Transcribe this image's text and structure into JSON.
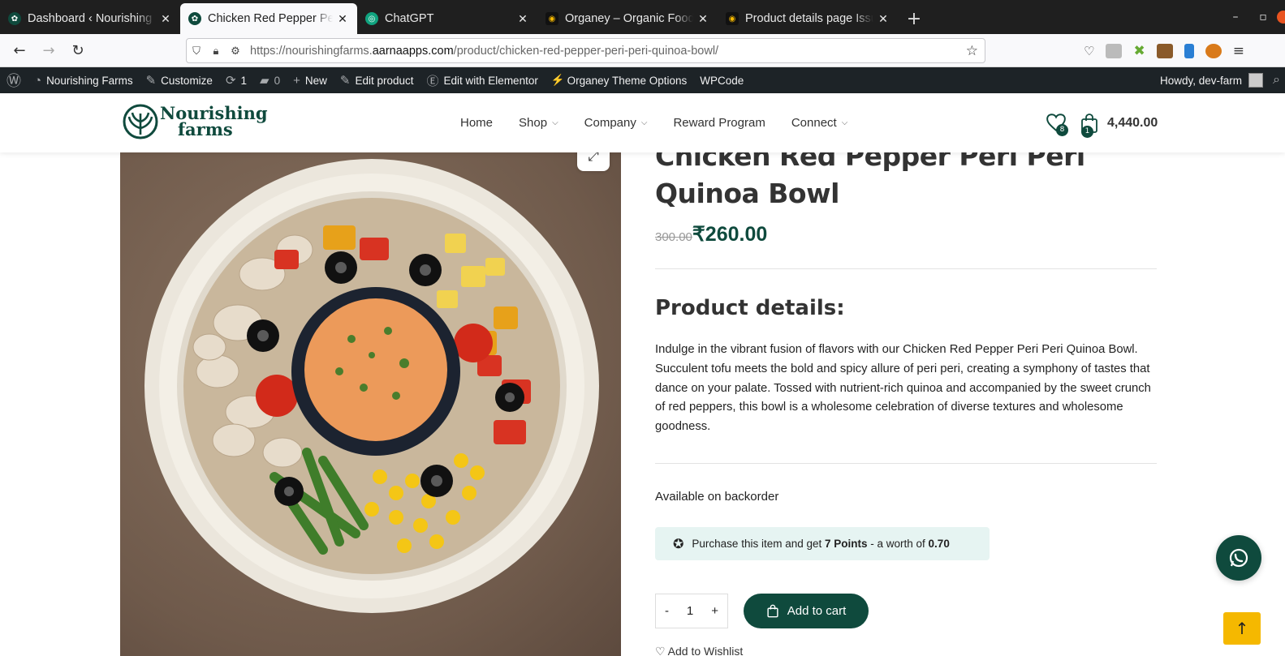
{
  "browser": {
    "tabs": [
      {
        "title": "Dashboard ‹ Nourishing Farms",
        "active": false
      },
      {
        "title": "Chicken Red Pepper Peri Peri",
        "active": true
      },
      {
        "title": "ChatGPT",
        "active": false
      },
      {
        "title": "Organey – Organic Food WordPress",
        "active": false
      },
      {
        "title": "Product details page Issues",
        "active": false
      }
    ],
    "url_prefix": "https://nourishingfarms.",
    "url_domain": "aarnaapps.com",
    "url_path": "/product/chicken-red-pepper-peri-peri-quinoa-bowl/"
  },
  "adminbar": {
    "site_name": "Nourishing Farms",
    "customize": "Customize",
    "updates_count": "1",
    "comments_count": "0",
    "new": "New",
    "edit_product": "Edit product",
    "edit_elementor": "Edit with Elementor",
    "theme_options": "Organey Theme Options",
    "wpcode": "WPCode",
    "howdy": "Howdy, dev-farm"
  },
  "header": {
    "logo_line1": "Nourishing",
    "logo_line2": "farms",
    "nav": [
      {
        "label": "Home",
        "dropdown": false
      },
      {
        "label": "Shop",
        "dropdown": true
      },
      {
        "label": "Company",
        "dropdown": true
      },
      {
        "label": "Reward Program",
        "dropdown": false
      },
      {
        "label": "Connect",
        "dropdown": true
      }
    ],
    "wishlist_count": "8",
    "cart_count": "1",
    "cart_total": "4,440.00"
  },
  "product": {
    "title": "Chicken Red Pepper Peri Peri Quinoa Bowl",
    "old_price": "300.00",
    "price": "₹260.00",
    "details_heading": "Product details:",
    "description": "Indulge in the vibrant fusion of flavors with our Chicken Red Pepper Peri Peri Quinoa Bowl. Succulent tofu meets the bold and spicy allure of peri peri, creating a symphony of tastes that dance on your palate. Tossed with nutrient-rich quinoa and accompanied by the sweet crunch of red peppers, this bowl is a wholesome celebration of diverse textures and wholesome goodness.",
    "stock": "Available on backorder",
    "reward_prefix": "Purchase this item and get ",
    "reward_points": "7 Points",
    "reward_mid": " - a worth of ",
    "reward_value": "0.70",
    "qty_minus": "-",
    "qty_value": "1",
    "qty_plus": "+",
    "add_to_cart": "Add to cart",
    "wishlist_link": "Add to Wishlist"
  },
  "colors": {
    "brand": "#0f4a3d",
    "accent": "#f5b800",
    "reward_bg": "#e6f4f2"
  }
}
